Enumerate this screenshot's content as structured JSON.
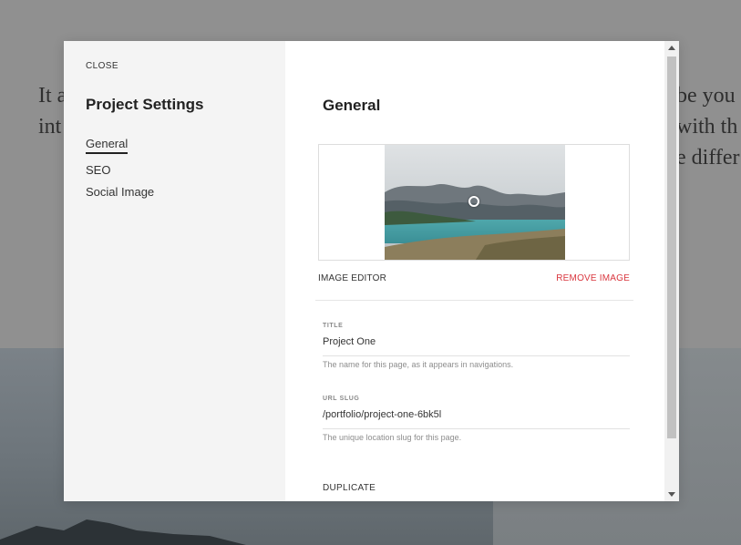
{
  "background": {
    "left_text": [
      "It a",
      "int"
    ],
    "right_text": [
      "be you",
      "with th",
      "e differ"
    ]
  },
  "modal": {
    "close_label": "CLOSE",
    "sidebar_title": "Project Settings",
    "nav": [
      {
        "label": "General",
        "active": true
      },
      {
        "label": "SEO",
        "active": false
      },
      {
        "label": "Social Image",
        "active": false
      }
    ],
    "section_title": "General",
    "image": {
      "editor_label": "IMAGE EDITOR",
      "remove_label": "REMOVE IMAGE"
    },
    "title_field": {
      "label": "TITLE",
      "value": "Project One",
      "help": "The name for this page, as it appears in navigations."
    },
    "slug_field": {
      "label": "URL SLUG",
      "value": "/portfolio/project-one-6bk5l",
      "help": "The unique location slug for this page."
    },
    "duplicate_label": "DUPLICATE"
  },
  "colors": {
    "danger": "#d9363e",
    "sidebar_bg": "#f4f4f4",
    "overlay_bg": "#8f8f8f"
  }
}
